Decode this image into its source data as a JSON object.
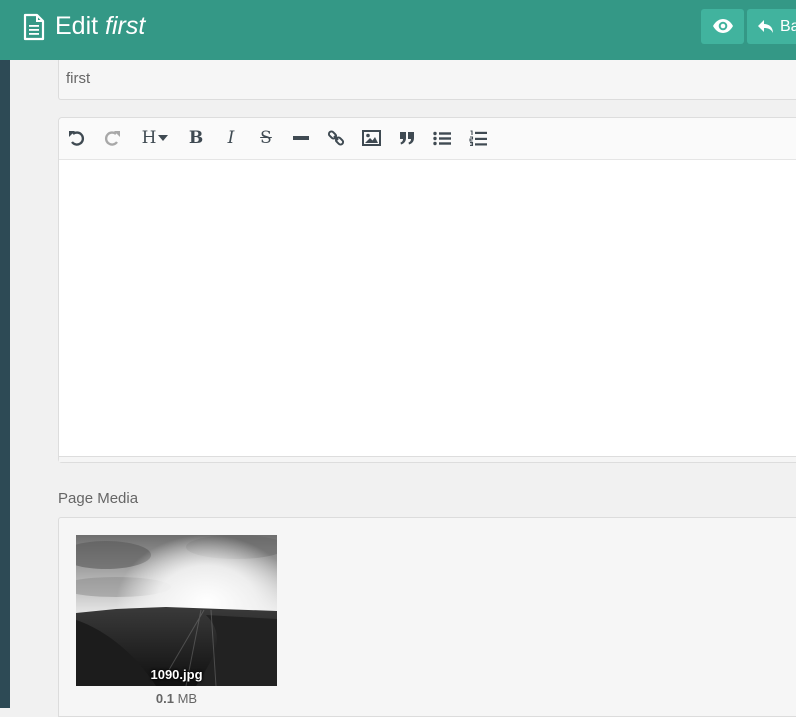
{
  "header": {
    "title_prefix": "Edit",
    "title_name": "first",
    "back_label": "Back",
    "color": "#349886",
    "button_color": "#41b39e",
    "icons": [
      "document-icon",
      "eye-icon",
      "reply-icon"
    ]
  },
  "form": {
    "title_value": "first"
  },
  "editor": {
    "toolbar": {
      "heading_label": "H",
      "bold_label": "B",
      "italic_label": "I",
      "strike_label": "S",
      "icons": [
        "undo-icon",
        "redo-icon",
        "heading-icon",
        "bold-icon",
        "italic-icon",
        "strikethrough-icon",
        "horizontal-rule-icon",
        "link-icon",
        "image-icon",
        "quote-icon",
        "unordered-list-icon",
        "ordered-list-icon"
      ]
    },
    "content": ""
  },
  "media": {
    "label": "Page Media",
    "items": [
      {
        "name": "1090.jpg",
        "size_value": "0.1",
        "size_unit": "MB"
      }
    ]
  }
}
